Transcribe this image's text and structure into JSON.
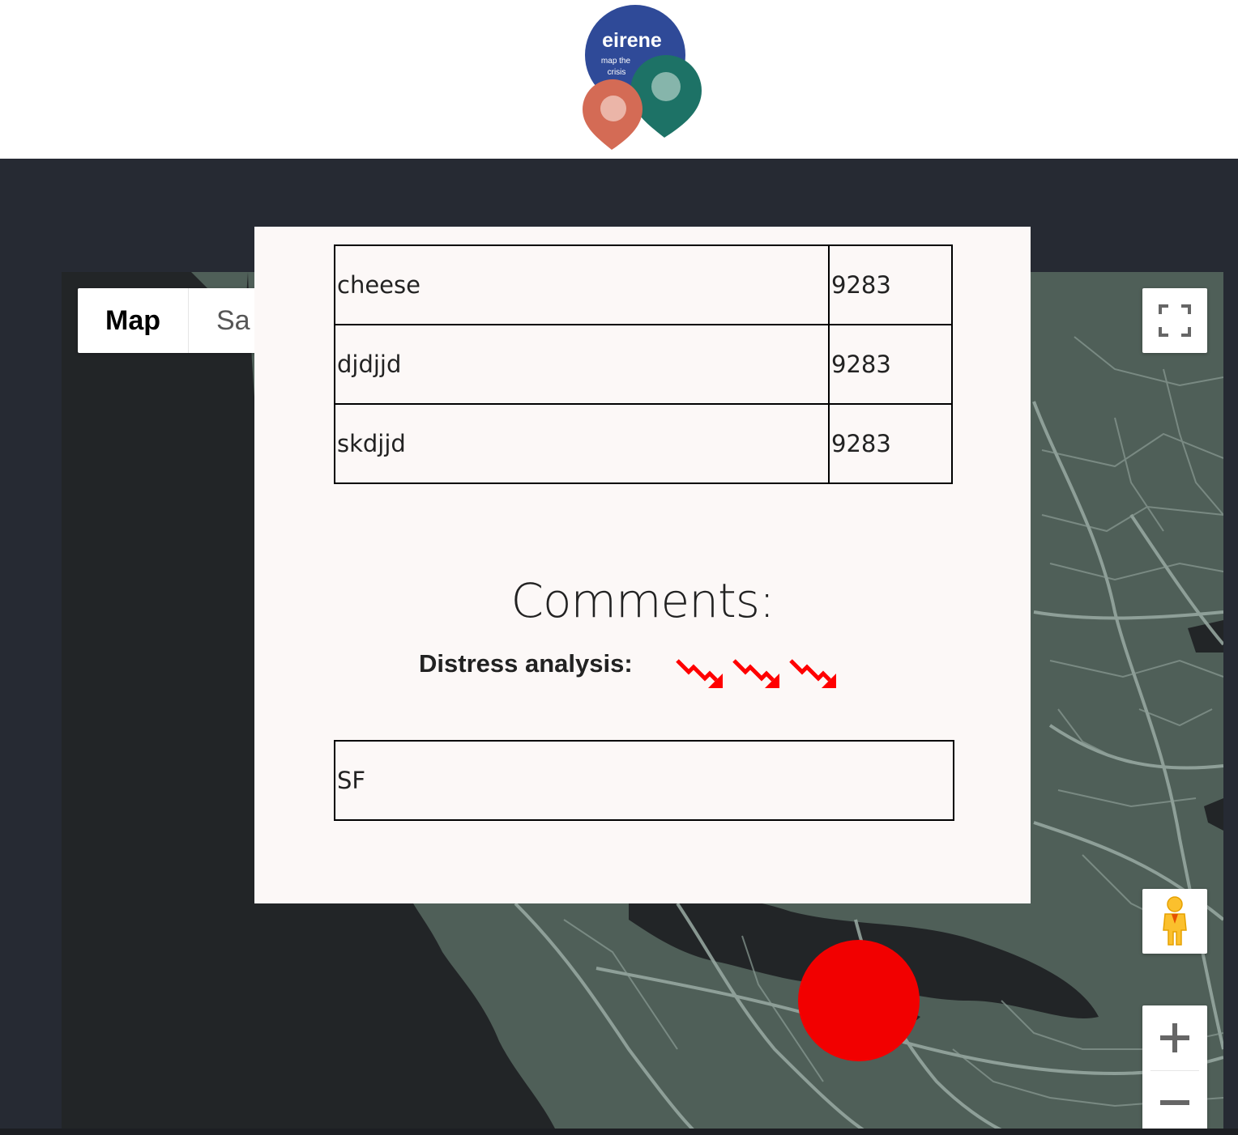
{
  "header": {
    "logo": {
      "brand": "eirene",
      "tagline_line1": "map the",
      "tagline_line2": "crisis",
      "colors": {
        "circle": "#2f4a98",
        "pin_left": "#d46b55",
        "pin_right": "#1d7266"
      }
    }
  },
  "map": {
    "map_type_options": [
      "Map",
      "Satellite"
    ],
    "selected_map_type": "Map",
    "map_label": "Map",
    "satellite_label": "Sa",
    "colors": {
      "land": "#4f5f58",
      "water": "#222527",
      "roads": "#9aaba4"
    }
  },
  "info_panel": {
    "table": {
      "rows": [
        {
          "name": "cheese",
          "value": "9283"
        },
        {
          "name": "djdjjd",
          "value": "9283"
        },
        {
          "name": "skdjjd",
          "value": "9283"
        }
      ]
    },
    "comments_title": "Comments:",
    "distress_label": "Distress analysis:",
    "distress_icon_count": 3,
    "distress_icon": "trend-down-arrow-icon",
    "distress_color": "#ff0000",
    "comment_text": "SF"
  },
  "marker": {
    "color": "#f20000"
  }
}
